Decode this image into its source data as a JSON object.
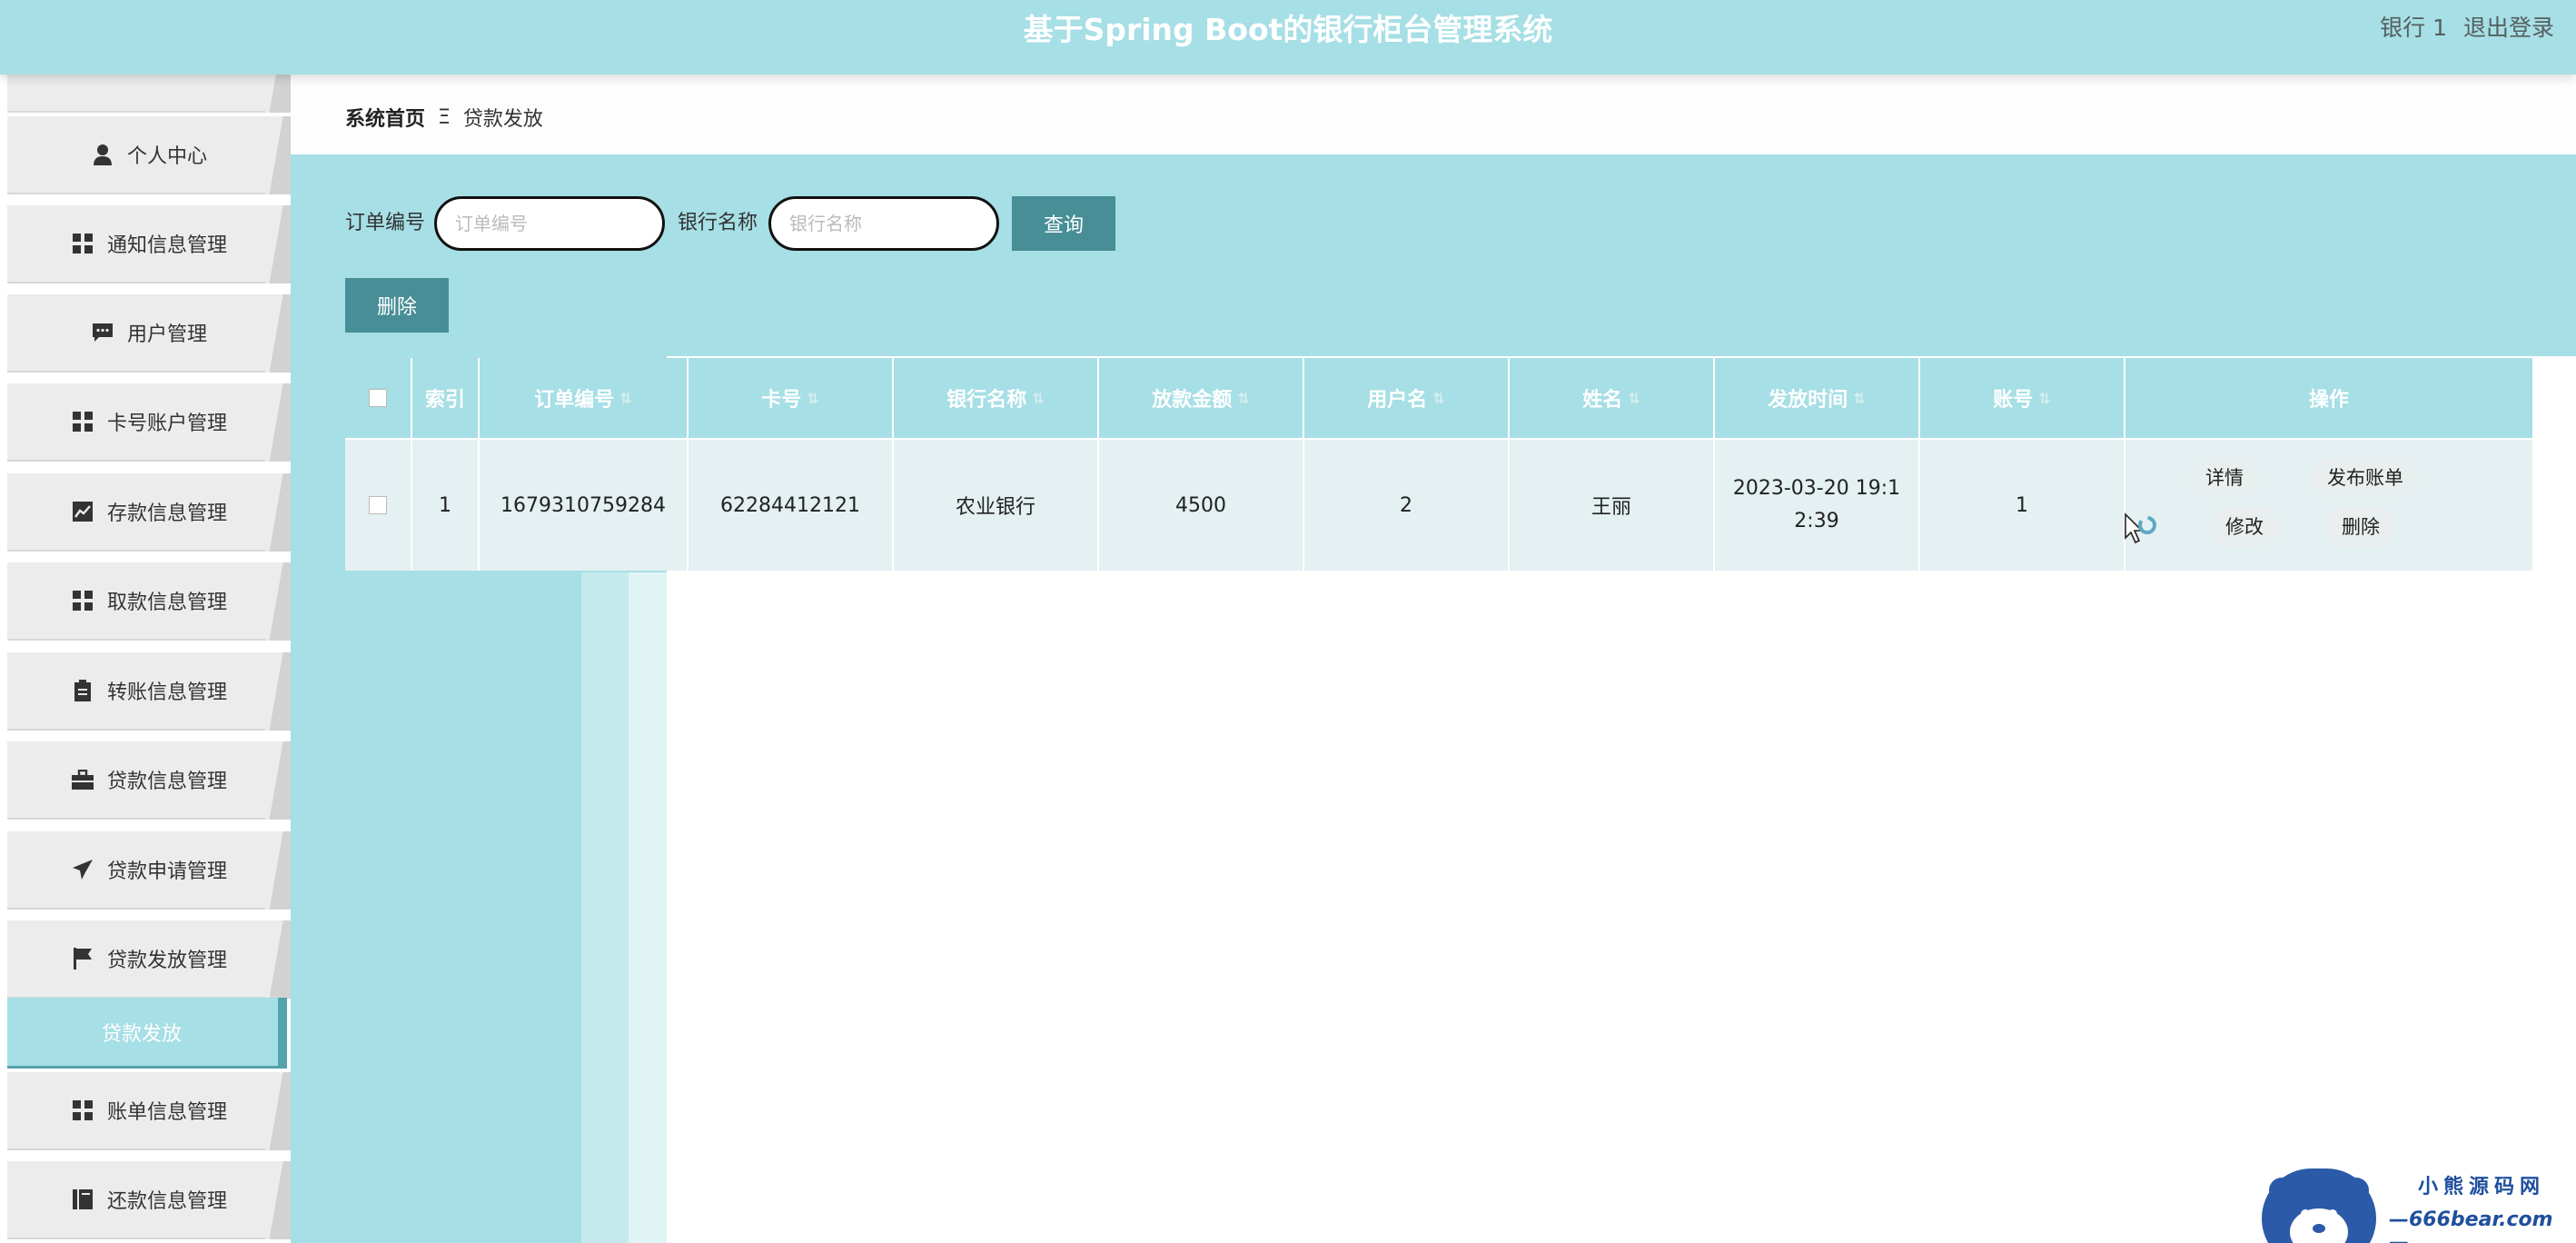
{
  "header": {
    "title": "基于Spring Boot的银行柜台管理系统",
    "user": "银行 1",
    "logout": "退出登录"
  },
  "sidebar": {
    "items": [
      {
        "label": "个人中心",
        "icon": "user-icon"
      },
      {
        "label": "通知信息管理",
        "icon": "grid-icon"
      },
      {
        "label": "用户管理",
        "icon": "chat-icon"
      },
      {
        "label": "卡号账户管理",
        "icon": "grid-icon"
      },
      {
        "label": "存款信息管理",
        "icon": "chart-icon"
      },
      {
        "label": "取款信息管理",
        "icon": "grid-icon"
      },
      {
        "label": "转账信息管理",
        "icon": "clipboard-icon"
      },
      {
        "label": "贷款信息管理",
        "icon": "briefcase-icon"
      },
      {
        "label": "贷款申请管理",
        "icon": "send-icon"
      },
      {
        "label": "贷款发放管理",
        "icon": "flag-icon"
      },
      {
        "label": "账单信息管理",
        "icon": "grid-icon"
      },
      {
        "label": "还款信息管理",
        "icon": "book-icon"
      }
    ],
    "active_sub": "贷款发放"
  },
  "breadcrumb": {
    "home": "系统首页",
    "separator": "Ξ",
    "current": "贷款发放"
  },
  "search": {
    "order_label": "订单编号",
    "order_placeholder": "订单编号",
    "bank_label": "银行名称",
    "bank_placeholder": "银行名称",
    "query_button": "查询"
  },
  "toolbar": {
    "delete_button": "删除"
  },
  "table": {
    "headers": {
      "index": "索引",
      "order": "订单编号",
      "card": "卡号",
      "bank": "银行名称",
      "amount": "放款金额",
      "user": "用户名",
      "name": "姓名",
      "time": "发放时间",
      "account": "账号",
      "ops": "操作"
    },
    "rows": [
      {
        "index": "1",
        "order": "1679310759284",
        "card": "62284412121",
        "bank": "农业银行",
        "amount": "4500",
        "user": "2",
        "name": "王丽",
        "time": "2023-03-20 19:12:39",
        "account": "1",
        "actions": {
          "detail": "详情",
          "publish": "发布账单",
          "edit": "修改",
          "delete": "删除"
        }
      }
    ]
  },
  "watermark": {
    "line1": "小熊源码网",
    "line2": "—666bear.com—"
  },
  "colors": {
    "teal_light": "#a6dfe5",
    "teal_dark": "#478e96",
    "row_bg": "#e4f0f1"
  }
}
